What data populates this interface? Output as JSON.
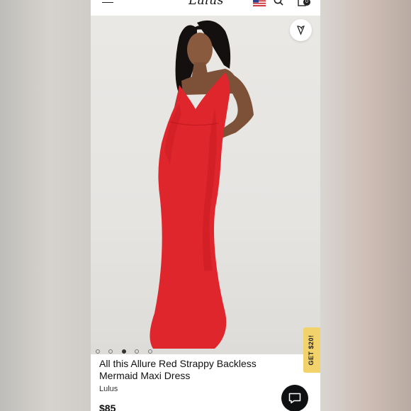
{
  "header": {
    "logo_text": "Lulus",
    "cart_count": "0",
    "icons": [
      "menu-icon",
      "us-flag-icon",
      "search-icon",
      "bag-icon"
    ]
  },
  "gallery": {
    "favorite_icon": "heart-icon",
    "dots_total": 5,
    "active_dot": 3
  },
  "promo_tab": {
    "label": "GET $20!"
  },
  "product": {
    "title": "All this Allure Red Strappy Backless Mermaid Maxi Dress",
    "brand": "Lulus",
    "price": "$85"
  },
  "chat": {
    "icon": "chat-icon"
  },
  "colors": {
    "dress_red": "#e0262d",
    "promo_yellow": "#f2d26b",
    "chat_bg": "#0f1011"
  }
}
